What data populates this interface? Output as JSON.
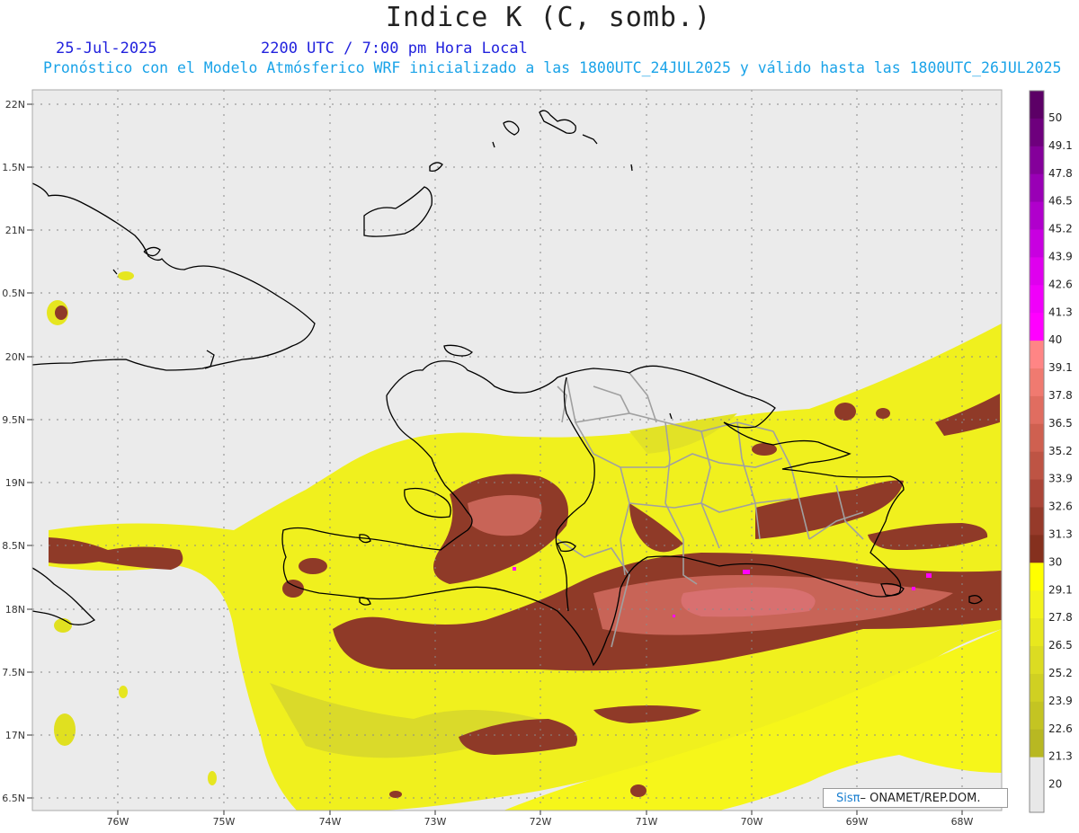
{
  "title": "Indice K (C, somb.)",
  "date": "25-Jul-2025",
  "time": "2200 UTC / 7:00 pm Hora Local",
  "subtitle": "Pronóstico con el Modelo Atmósferico WRF inicializado a las 1800UTC_24JUL2025 y válido hasta las  1800UTC_26JUL2025",
  "credit": {
    "brand": "Sisπ",
    "org": "– ONAMET/REP.DOM."
  },
  "lat_labels": [
    "22N",
    "1.5N",
    "21N",
    "0.5N",
    "20N",
    "9.5N",
    "19N",
    "8.5N",
    "18N",
    "7.5N",
    "17N",
    "6.5N"
  ],
  "lon_labels": [
    "76W",
    "75W",
    "74W",
    "73W",
    "72W",
    "71W",
    "70W",
    "69W",
    "68W"
  ],
  "colorbar": {
    "levels": [
      "50",
      "49.1",
      "47.8",
      "46.5",
      "45.2",
      "43.9",
      "42.6",
      "41.3",
      "40",
      "39.1",
      "37.8",
      "36.5",
      "35.2",
      "33.9",
      "32.6",
      "31.3",
      "30",
      "29.1",
      "27.8",
      "26.5",
      "25.2",
      "23.9",
      "22.6",
      "21.3",
      "20"
    ],
    "colors": [
      "#5c0066",
      "#6e007d",
      "#84009a",
      "#9900b5",
      "#b000cc",
      "#c800e0",
      "#df00ee",
      "#f000fa",
      "#ff00ff",
      "#ff8585",
      "#f07a70",
      "#e06d60",
      "#cf6050",
      "#be5444",
      "#ab4638",
      "#963a2a",
      "#85301e",
      "#ffff00",
      "#f3f31a",
      "#e8e81e",
      "#dcdc22",
      "#d0d022",
      "#c4c422",
      "#b8b822"
    ],
    "below_color": "#e8e8e8"
  },
  "map_colors": {
    "background": "#ebebeb",
    "yellow": "#f6f61a",
    "yellow_dark": "#d6d630",
    "brown": "#8f3a28",
    "pink": "#d87070",
    "magenta": "#ff00ff",
    "coast": "#000000",
    "provinces": "#a0a0a0"
  }
}
